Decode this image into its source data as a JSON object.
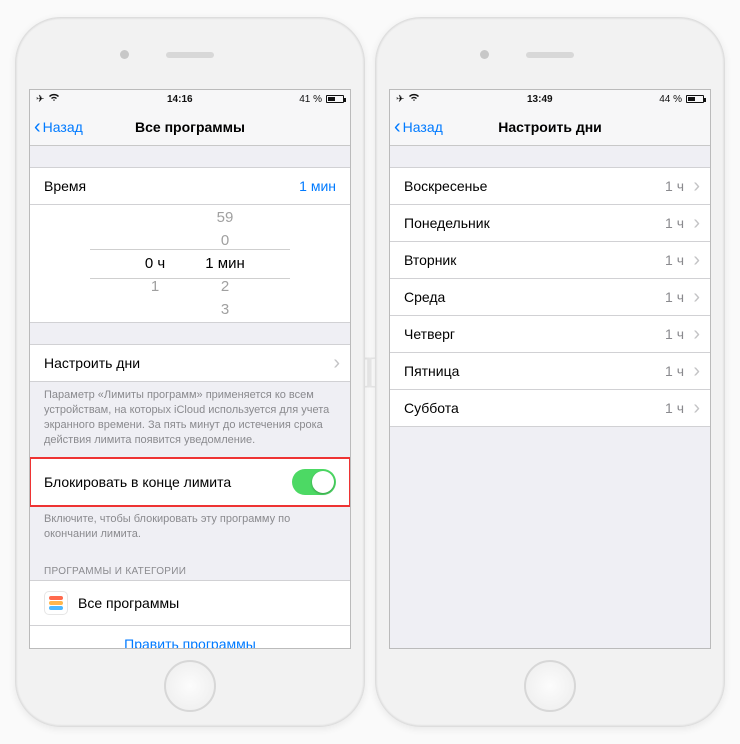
{
  "left": {
    "status": {
      "time": "14:16",
      "battery_pct": "41 %",
      "battery_fill_pct": 41
    },
    "nav": {
      "back": "Назад",
      "title": "Все программы"
    },
    "time_row": {
      "label": "Время",
      "value": "1 мин"
    },
    "picker": {
      "hours_above": "",
      "hours_sel": "0 ч",
      "hours_b1": "1",
      "hours_b2": "",
      "min_a1": "59",
      "min_a2": "0",
      "min_sel": "1 мин",
      "min_b1": "2",
      "min_b2": "3"
    },
    "customize_days": "Настроить дни",
    "limits_footer": "Параметр «Лимиты программ» применяется ко всем устройствам, на которых iCloud используется для учета экранного времени. За пять минут до истечения срока действия лимита появится уведомление.",
    "block_row": {
      "label": "Блокировать в конце лимита",
      "on": true
    },
    "block_footer": "Включите, чтобы блокировать эту программу по окончании лимита.",
    "section_header": "ПРОГРАММЫ И КАТЕГОРИИ",
    "all_programs": "Все программы",
    "edit_programs": "Править программы"
  },
  "right": {
    "status": {
      "time": "13:49",
      "battery_pct": "44 %",
      "battery_fill_pct": 44
    },
    "nav": {
      "back": "Назад",
      "title": "Настроить дни"
    },
    "days": [
      {
        "name": "Воскресенье",
        "value": "1 ч"
      },
      {
        "name": "Понедельник",
        "value": "1 ч"
      },
      {
        "name": "Вторник",
        "value": "1 ч"
      },
      {
        "name": "Среда",
        "value": "1 ч"
      },
      {
        "name": "Четверг",
        "value": "1 ч"
      },
      {
        "name": "Пятница",
        "value": "1 ч"
      },
      {
        "name": "Суббота",
        "value": "1 ч"
      }
    ]
  },
  "watermark": "ЯБЛЫК"
}
